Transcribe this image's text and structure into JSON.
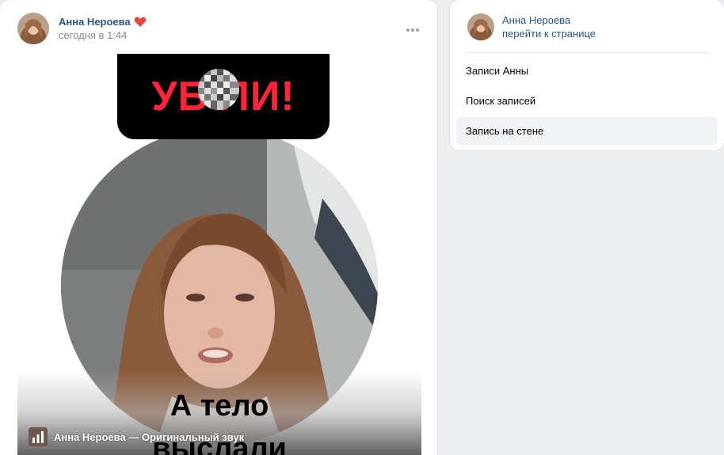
{
  "post": {
    "author_name": "Анна Нероева",
    "time": "сегодня в 1:44",
    "icons": {
      "heart": "heart-icon",
      "more": "more-horizontal-icon"
    },
    "banner_text": "УБ   ЛИ!",
    "caption_line_1": "А тело",
    "caption_line_2": "выслали",
    "audio_label": "Анна Нероева — Оригинальный звук"
  },
  "sidebar": {
    "profile_name": "Анна Нероева",
    "profile_link": "перейти к странице",
    "menu": [
      {
        "label": "Записи Анны",
        "active": false
      },
      {
        "label": "Поиск записей",
        "active": false
      },
      {
        "label": "Запись на стене",
        "active": true
      }
    ]
  },
  "colors": {
    "link": "#2a5885",
    "secondary_text": "#818c99",
    "banner_red": "#ff2438",
    "heart": "#e64646",
    "page_bg": "#edeef0",
    "active_item_bg": "#f0f2f5"
  }
}
